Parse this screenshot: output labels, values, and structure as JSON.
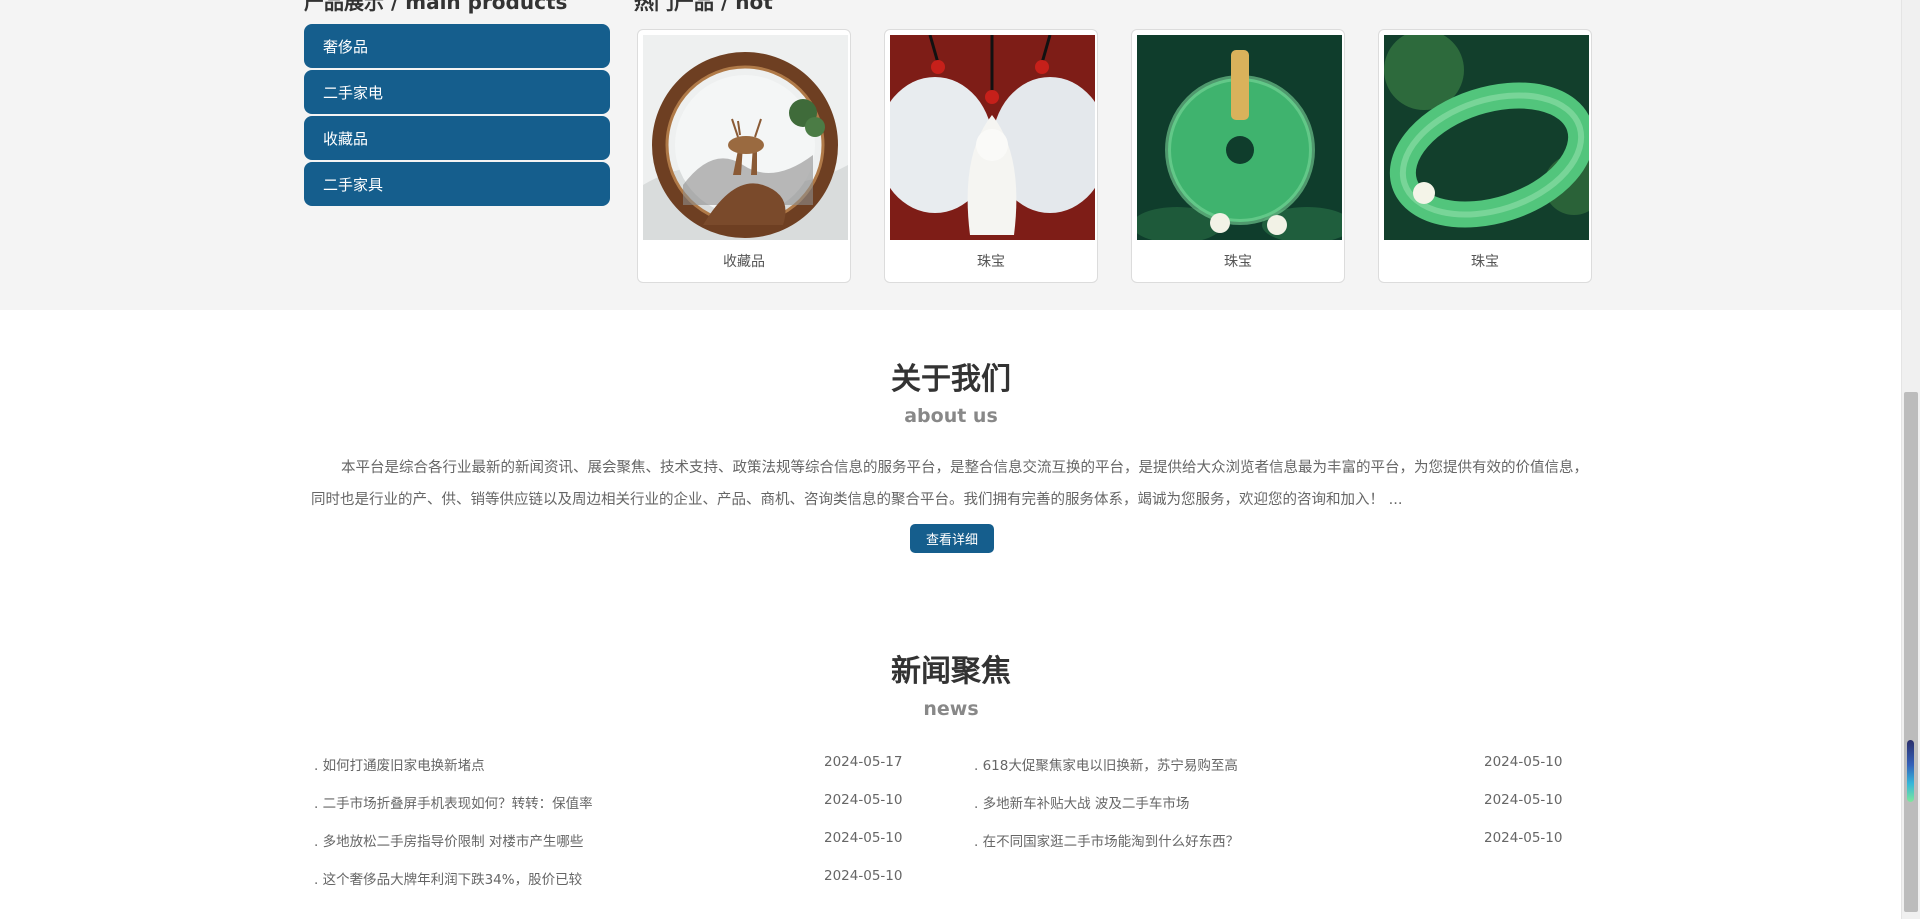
{
  "products_section": {
    "title_cut": "产品展示 / main products",
    "hot_title_cut": "热门产品 / hot"
  },
  "categories": [
    {
      "label": "奢侈品"
    },
    {
      "label": "二手家电"
    },
    {
      "label": "收藏品"
    },
    {
      "label": "二手家具"
    }
  ],
  "products": [
    {
      "label": "收藏品",
      "icon": "deer-ornament-image"
    },
    {
      "label": "珠宝",
      "icon": "jade-pendant-image"
    },
    {
      "label": "珠宝",
      "icon": "jade-donut-image"
    },
    {
      "label": "珠宝",
      "icon": "jade-bangle-image"
    }
  ],
  "about": {
    "title": "关于我们",
    "subtitle": "about us",
    "text": "本平台是综合各行业最新的新闻资讯、展会聚焦、技术支持、政策法规等综合信息的服务平台，是整合信息交流互换的平台，是提供给大众浏览者信息最为丰富的平台，为您提供有效的价值信息，同时也是行业的产、供、销等供应链以及周边相关行业的企业、产品、商机、咨询类信息的聚合平台。我们拥有完善的服务体系，竭诚为您服务，欢迎您的咨询和加入！ ...",
    "button_label": "查看详细"
  },
  "news": {
    "title": "新闻聚焦",
    "subtitle": "news",
    "left": [
      {
        "title": ". 如何打通废旧家电换新堵点",
        "date": "2024-05-17"
      },
      {
        "title": ". 二手市场折叠屏手机表现如何？转转：保值率",
        "date": "2024-05-10"
      },
      {
        "title": ". 多地放松二手房指导价限制 对楼市产生哪些",
        "date": "2024-05-10"
      },
      {
        "title": ". 这个奢侈品大牌年利润下跌34%，股价已较",
        "date": "2024-05-10"
      }
    ],
    "right": [
      {
        "title": ". 618大促聚焦家电以旧换新，苏宁易购至高",
        "date": "2024-05-10"
      },
      {
        "title": ". 多地新车补贴大战 波及二手车市场",
        "date": "2024-05-10"
      },
      {
        "title": ". 在不同国家逛二手市场能淘到什么好东西？",
        "date": "2024-05-10"
      }
    ]
  },
  "colors": {
    "accent": "#155e8d",
    "band_bg": "#f4f4f4"
  }
}
